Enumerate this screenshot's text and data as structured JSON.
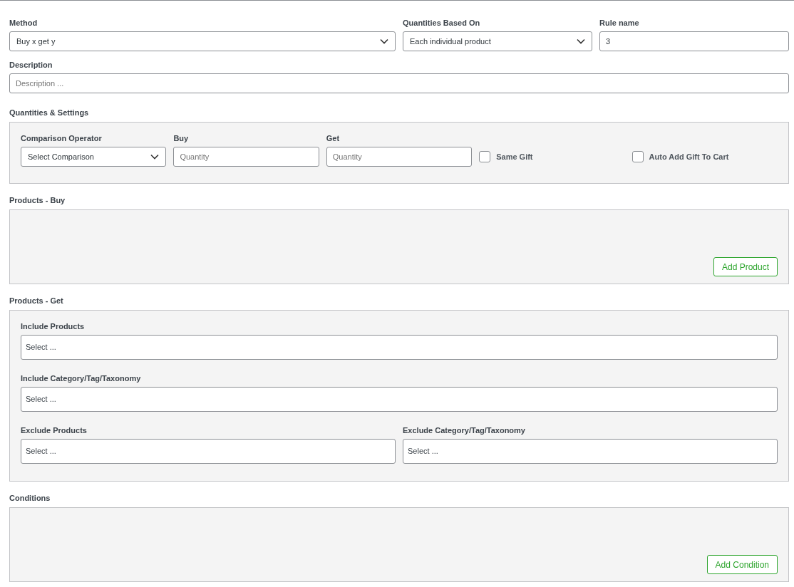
{
  "top_fields": [
    {
      "kind": "select",
      "label": "Method",
      "value": "Buy x get y"
    },
    {
      "kind": "select",
      "label": "Quantities Based On",
      "value": "Each individual product"
    },
    {
      "kind": "text",
      "label": "Rule name",
      "value": "3"
    }
  ],
  "description": {
    "label": "Description",
    "placeholder": "Description ..."
  },
  "quantities_settings": {
    "title": "Quantities & Settings",
    "fields": [
      {
        "kind": "select",
        "label": "Comparison Operator",
        "value": "Select Comparison"
      },
      {
        "kind": "text",
        "label": "Buy",
        "placeholder": "Quantity"
      },
      {
        "kind": "text",
        "label": "Get",
        "placeholder": "Quantity"
      },
      {
        "kind": "checkbox",
        "label": "Same Gift",
        "checked": false
      },
      {
        "kind": "checkbox",
        "label": "Auto Add Gift To Cart",
        "checked": false
      }
    ]
  },
  "products_buy": {
    "title": "Products - Buy",
    "button": "Add Product"
  },
  "products_get": {
    "title": "Products - Get",
    "fields": [
      {
        "label": "Include Products",
        "placeholder": "Select ..."
      },
      {
        "label": "Include Category/Tag/Taxonomy",
        "placeholder": "Select ..."
      },
      {
        "label": "Exclude Products",
        "placeholder": "Select ..."
      },
      {
        "label": "Exclude Category/Tag/Taxonomy",
        "placeholder": "Select ..."
      }
    ]
  },
  "conditions": {
    "title": "Conditions",
    "button": "Add Condition"
  }
}
